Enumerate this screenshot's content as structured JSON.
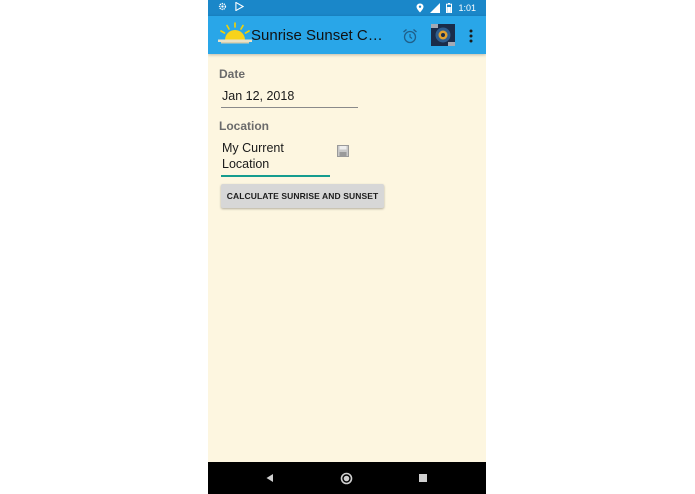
{
  "status_bar": {
    "time": "1:01",
    "left_icons": [
      "gear-icon",
      "play-store-icon"
    ],
    "right_icons": [
      "location-icon",
      "signal-icon",
      "battery-icon"
    ]
  },
  "app_bar": {
    "title": "Sunrise Sunset Calc…",
    "icons": [
      "sun-logo-icon",
      "alarm-clock-icon",
      "camera-icon",
      "overflow-menu-icon"
    ]
  },
  "form": {
    "date_label": "Date",
    "date_value": "Jan 12, 2018",
    "location_label": "Location",
    "location_value": "My Current Location",
    "calculate_button": "CALCULATE SUNRISE AND SUNSET"
  },
  "nav_bar": {
    "icons": [
      "back-icon",
      "home-icon",
      "recents-icon"
    ]
  },
  "colors": {
    "status_bar": "#1a87c9",
    "app_bar": "#29a6e8",
    "background": "#fdf6e0",
    "accent": "#159c8e",
    "button": "#d7d7d7"
  }
}
